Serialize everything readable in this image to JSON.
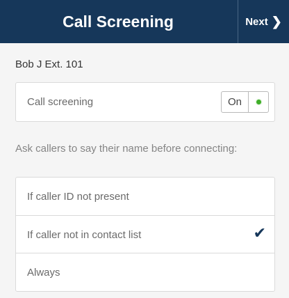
{
  "header": {
    "title": "Call Screening",
    "next_label": "Next",
    "next_icon": "chevron-right-icon"
  },
  "user": {
    "label": "Bob J Ext. 101"
  },
  "call_screening": {
    "label": "Call screening",
    "toggle_text": "On",
    "status_color": "#3fae29"
  },
  "instruction": "Ask callers to say their name before connecting:",
  "options": [
    {
      "label": "If caller ID not present",
      "selected": false
    },
    {
      "label": "If caller not in contact list",
      "selected": true,
      "check_icon": "✔"
    },
    {
      "label": "Always",
      "selected": false
    }
  ],
  "colors": {
    "header_bg": "#16375a",
    "accent": "#16375a",
    "toggle_on": "#3fae29"
  }
}
